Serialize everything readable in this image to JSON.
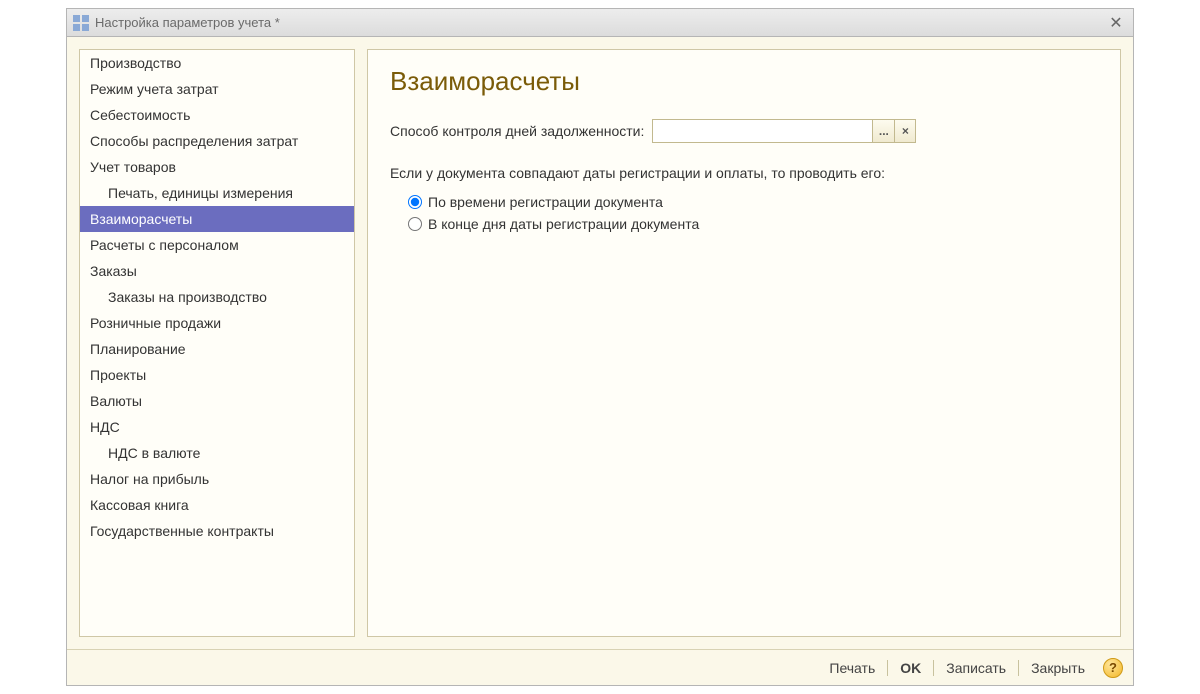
{
  "window": {
    "title": "Настройка параметров учета *"
  },
  "sidebar": {
    "items": [
      {
        "label": "Производство",
        "indent": false,
        "selected": false
      },
      {
        "label": "Режим учета затрат",
        "indent": false,
        "selected": false
      },
      {
        "label": "Себестоимость",
        "indent": false,
        "selected": false
      },
      {
        "label": "Способы распределения затрат",
        "indent": false,
        "selected": false
      },
      {
        "label": "Учет товаров",
        "indent": false,
        "selected": false
      },
      {
        "label": "Печать, единицы измерения",
        "indent": true,
        "selected": false
      },
      {
        "label": "Взаиморасчеты",
        "indent": false,
        "selected": true
      },
      {
        "label": "Расчеты с персоналом",
        "indent": false,
        "selected": false
      },
      {
        "label": "Заказы",
        "indent": false,
        "selected": false
      },
      {
        "label": "Заказы на производство",
        "indent": true,
        "selected": false
      },
      {
        "label": "Розничные продажи",
        "indent": false,
        "selected": false
      },
      {
        "label": "Планирование",
        "indent": false,
        "selected": false
      },
      {
        "label": "Проекты",
        "indent": false,
        "selected": false
      },
      {
        "label": "Валюты",
        "indent": false,
        "selected": false
      },
      {
        "label": "НДС",
        "indent": false,
        "selected": false
      },
      {
        "label": "НДС в валюте",
        "indent": true,
        "selected": false
      },
      {
        "label": "Налог на прибыль",
        "indent": false,
        "selected": false
      },
      {
        "label": "Кассовая книга",
        "indent": false,
        "selected": false
      },
      {
        "label": "Государственные контракты",
        "indent": false,
        "selected": false
      }
    ]
  },
  "main": {
    "heading": "Взаиморасчеты",
    "field_label": "Способ контроля дней задолженности:",
    "field_value": "",
    "select_btn": "...",
    "clear_btn": "×",
    "desc": "Если у документа совпадают даты регистрации и оплаты, то проводить его:",
    "radio1": "По времени регистрации документа",
    "radio2": "В конце дня даты регистрации документа",
    "radio_selected": 1
  },
  "footer": {
    "print": "Печать",
    "ok": "OK",
    "save": "Записать",
    "close": "Закрыть",
    "help": "?"
  }
}
